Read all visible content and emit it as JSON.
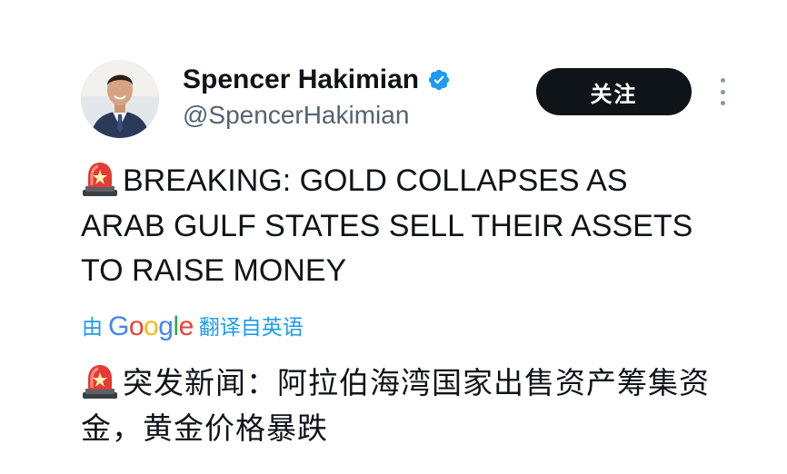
{
  "author": {
    "display_name": "Spencer Hakimian",
    "handle": "@SpencerHakimian",
    "verified": true,
    "avatar_icon": "person-avatar-icon"
  },
  "actions": {
    "follow_label": "关注",
    "more_icon": "more-vertical-icon"
  },
  "tweet": {
    "emoji": "siren-emoji-icon",
    "text": "BREAKING: GOLD COLLAPSES AS ARAB GULF STATES SELL THEIR ASSETS TO RAISE MONEY"
  },
  "translation": {
    "prefix": "由",
    "provider": "Google",
    "suffix": "翻译自英语",
    "text": "突发新闻：阿拉伯海湾国家出售资产筹集资金，黄金价格暴跌"
  },
  "colors": {
    "link": "#1d9bf0",
    "text": "#0f1419",
    "secondary": "#536471",
    "button": "#0f1419"
  }
}
